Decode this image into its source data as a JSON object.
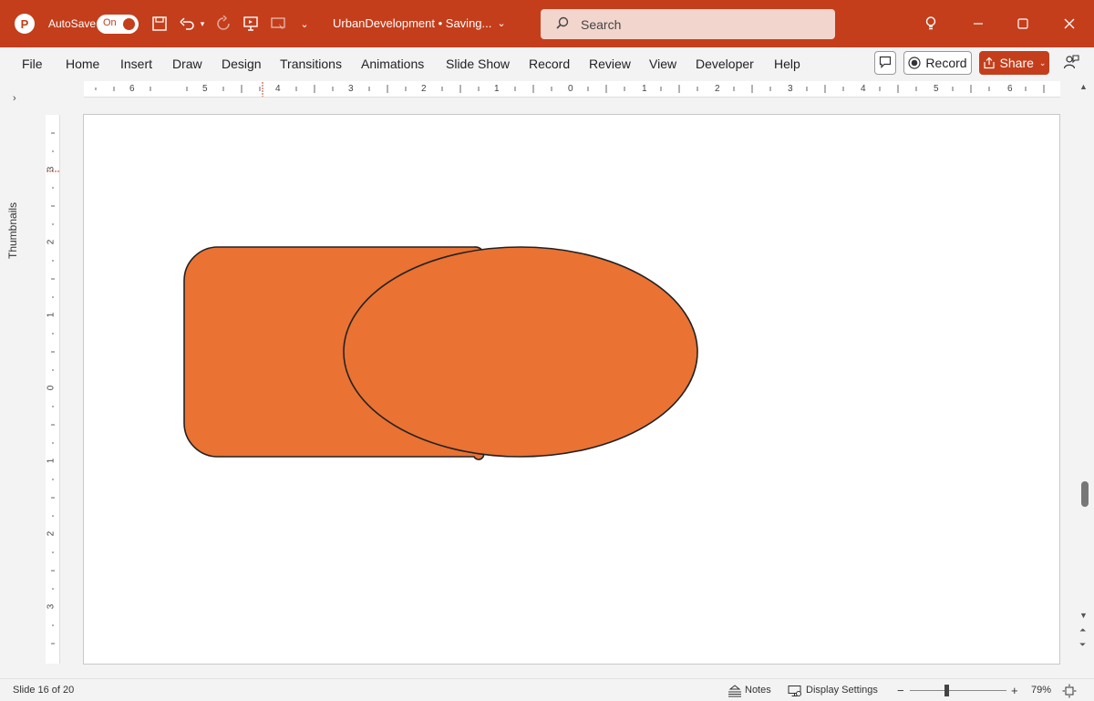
{
  "titlebar": {
    "app_icon_letter": "P",
    "autosave_label": "AutoSave",
    "autosave_state": "On",
    "document_title": "UrbanDevelopment • Saving...",
    "search_placeholder": "Search",
    "accent_color": "#c43e1c"
  },
  "ribbon": {
    "tabs": [
      "File",
      "Home",
      "Insert",
      "Draw",
      "Design",
      "Transitions",
      "Animations",
      "Slide Show",
      "Record",
      "Review",
      "View",
      "Developer",
      "Help"
    ],
    "record_label": "Record",
    "share_label": "Share"
  },
  "thumbnails": {
    "label": "Thumbnails"
  },
  "ruler": {
    "horizontal": [
      "6",
      "5",
      "4",
      "3",
      "2",
      "1",
      "0",
      "1",
      "2",
      "3",
      "4",
      "5",
      "6"
    ],
    "vertical": [
      "3",
      "2",
      "1",
      "0",
      "1",
      "2",
      "3"
    ]
  },
  "slide": {
    "shape_fill": "#ea7232",
    "shape_stroke": "#222222",
    "shapes": [
      "rounded-rectangle",
      "ellipse"
    ]
  },
  "statusbar": {
    "slide_indicator": "Slide 16 of 20",
    "notes_label": "Notes",
    "display_settings_label": "Display Settings",
    "zoom_minus": "−",
    "zoom_plus": "+",
    "zoom_level": "79%"
  }
}
